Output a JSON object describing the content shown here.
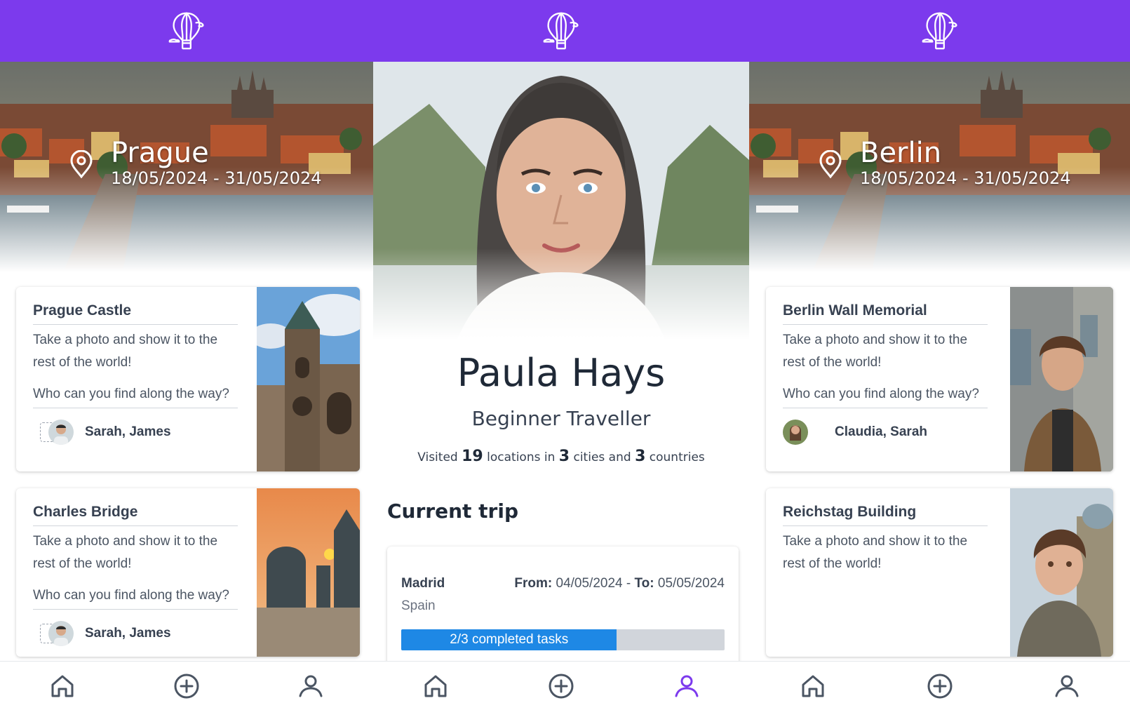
{
  "colors": {
    "brand": "#7c3aed",
    "progress": "#1e88e5",
    "nav_active": "#7c3aed",
    "nav_inactive": "#4b5563"
  },
  "left_panel": {
    "city": "Prague",
    "dates": "18/05/2024 - 31/05/2024",
    "cards": [
      {
        "title": "Prague Castle",
        "description": "Take a photo and show it to the rest of the world!",
        "question": "Who can you find along the way?",
        "people": "Sarah, James",
        "photo_icon": "cathedral-photo"
      },
      {
        "title": "Charles Bridge",
        "description": "Take a photo and show it to the rest of the world!",
        "question": "Who can you find along the way?",
        "people": "Sarah, James",
        "photo_icon": "bridge-sunset-photo"
      }
    ],
    "nav": [
      "home-icon",
      "add-icon",
      "profile-icon"
    ]
  },
  "middle_panel": {
    "name": "Paula Hays",
    "level": "Beginner Traveller",
    "stats": {
      "prefix": "Visited",
      "locations": "19",
      "locations_label": "locations in",
      "cities": "3",
      "cities_label": "cities and",
      "countries": "3",
      "countries_label": "countries"
    },
    "current_trip_heading": "Current trip",
    "trip": {
      "city": "Madrid",
      "country": "Spain",
      "from_label": "From:",
      "from": "04/05/2024",
      "separator": "-",
      "to_label": "To:",
      "to": "05/05/2024",
      "progress_text": "2/3 completed tasks",
      "progress": 0.667
    },
    "nav_active": "profile"
  },
  "right_panel": {
    "city": "Berlin",
    "dates": "18/05/2024 - 31/05/2024",
    "cards": [
      {
        "title": "Berlin Wall Memorial",
        "description": "Take a photo and show it to the rest of the world!",
        "question": "Who can you find along the way?",
        "people": "Claudia, Sarah",
        "photo_icon": "berlin-wall-photo"
      },
      {
        "title": "Reichstag Building",
        "description": "Take a photo and show it to the rest of the world!",
        "photo_icon": "reichstag-photo"
      }
    ]
  }
}
